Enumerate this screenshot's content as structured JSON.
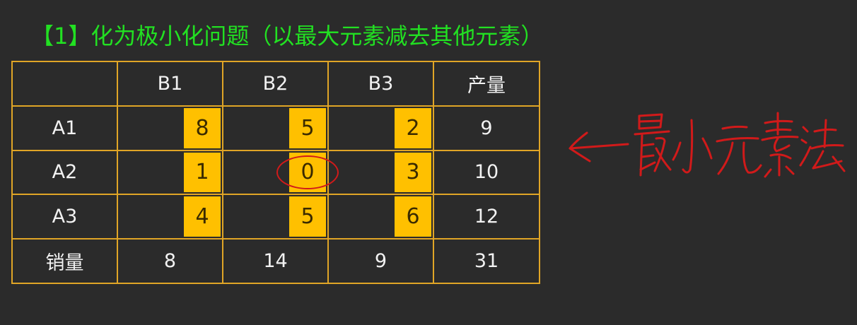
{
  "title": "【1】化为极小化问题（以最大元素减去其他元素）",
  "table": {
    "col_headers": [
      "",
      "B1",
      "B2",
      "B3",
      "产量"
    ],
    "rows": [
      {
        "label": "A1",
        "costs": [
          "8",
          "5",
          "2"
        ],
        "supply": "9"
      },
      {
        "label": "A2",
        "costs": [
          "1",
          "0",
          "3"
        ],
        "supply": "10"
      },
      {
        "label": "A3",
        "costs": [
          "4",
          "5",
          "6"
        ],
        "supply": "12"
      }
    ],
    "demand_row": {
      "label": "销量",
      "values": [
        "8",
        "14",
        "9"
      ],
      "total": "31"
    }
  },
  "annotation": {
    "text": "←最小元素法",
    "circled_cell": "A2-B2"
  },
  "colors": {
    "background": "#2b2b2b",
    "title": "#22e022",
    "grid_line": "#e0a526",
    "cost_box": "#ffc000",
    "annotation": "#d11a1a"
  }
}
